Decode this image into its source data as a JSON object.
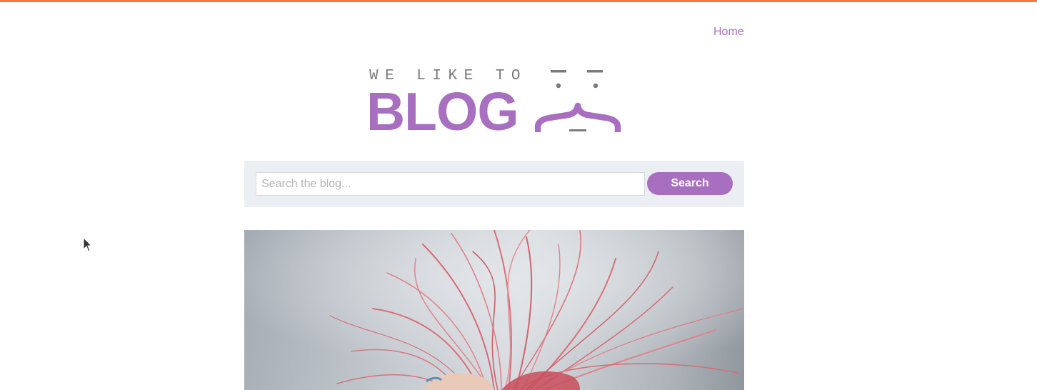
{
  "nav": {
    "home_label": "Home"
  },
  "logo": {
    "tagline": "WE LIKE TO",
    "wordmark": "BLOG"
  },
  "search": {
    "placeholder": "Search the blog...",
    "value": "",
    "button_label": "Search"
  },
  "hero": {
    "image": "photo of a person with wind-blown pink-red hair"
  },
  "colors": {
    "accent": "#a86fc0",
    "top_bar": "#f07a43",
    "search_panel_bg": "#ebeef2",
    "hair": "#d9707a"
  }
}
